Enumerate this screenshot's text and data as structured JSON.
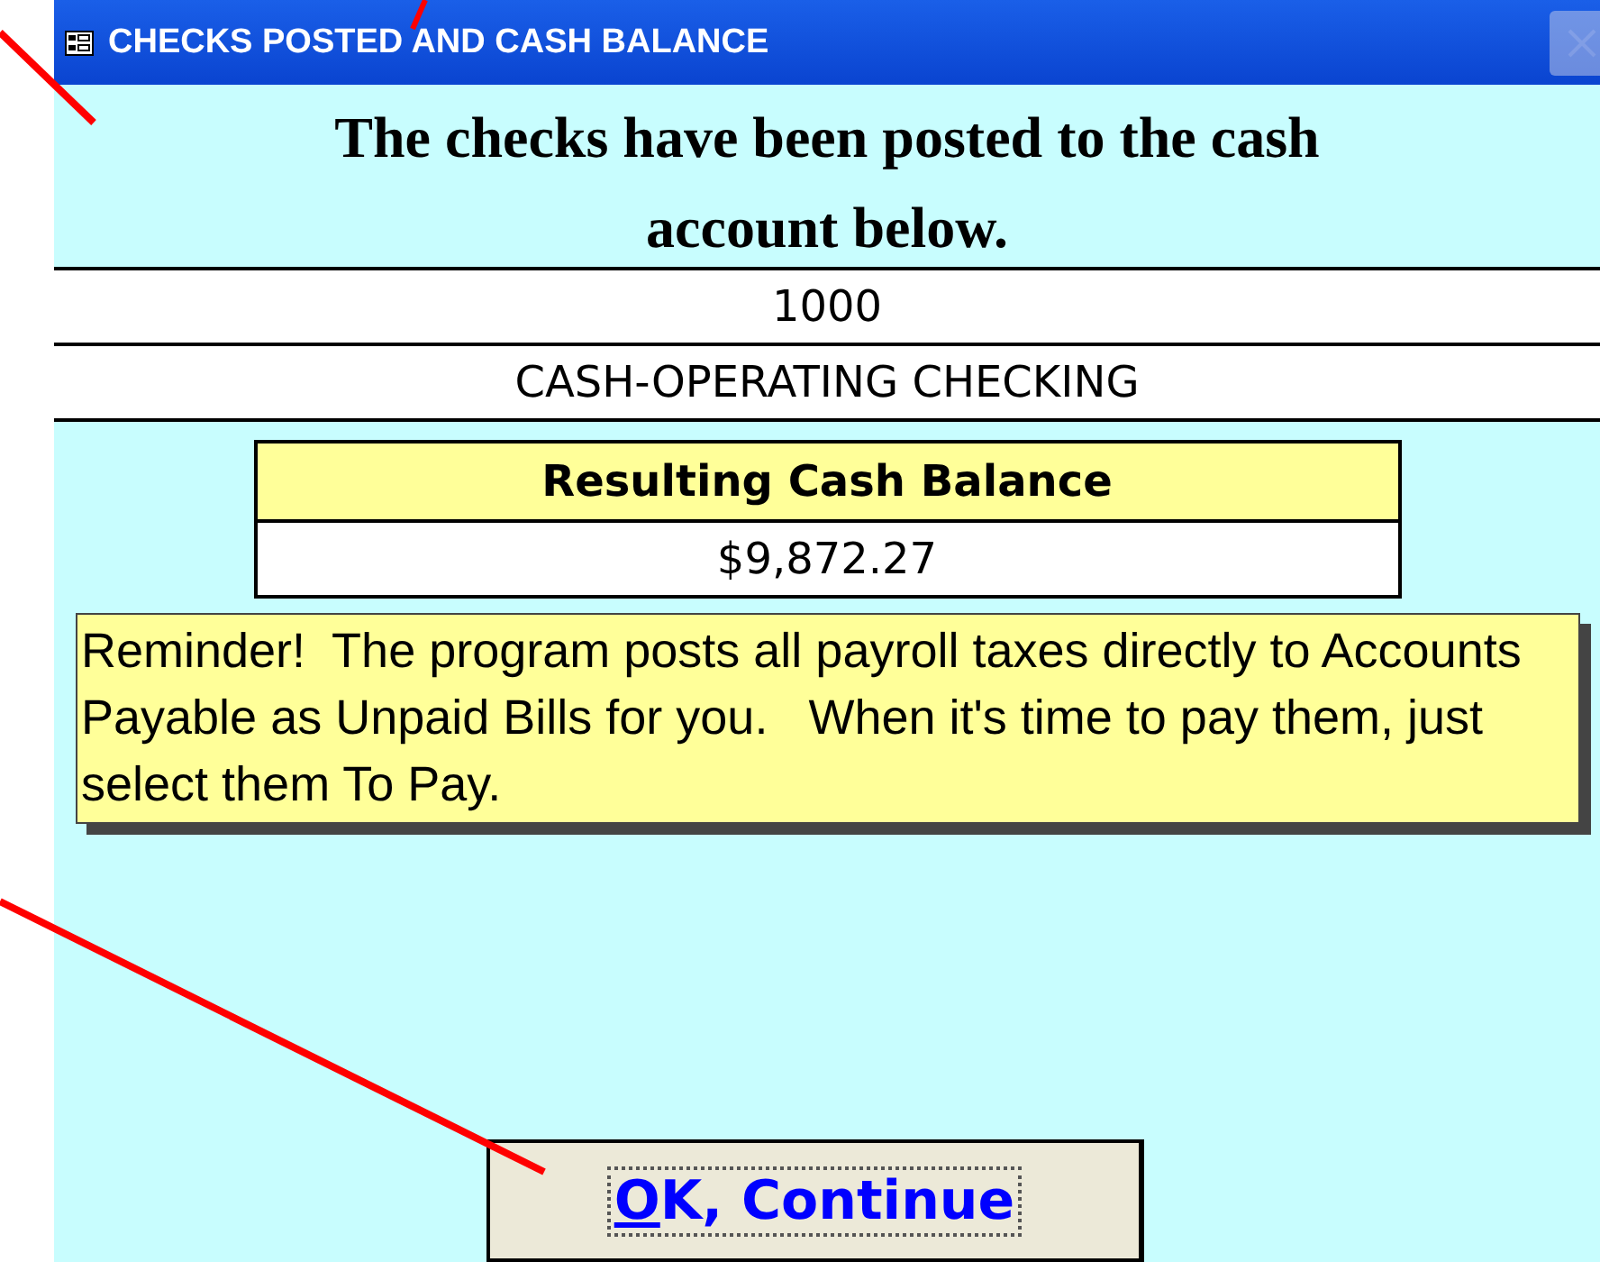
{
  "window": {
    "title": "CHECKS POSTED AND CASH BALANCE"
  },
  "heading": "The checks have been posted to the cash account below.",
  "account": {
    "number": "1000",
    "name": "CASH-OPERATING CHECKING"
  },
  "balance": {
    "label": "Resulting Cash Balance",
    "value": "$9,872.27"
  },
  "reminder": "Reminder!  The program posts all payroll taxes directly to Accounts Payable as Unpaid Bills for you.   When it's time to pay them, just select them To Pay.",
  "button": {
    "label": "OK, Continue",
    "focused": true
  }
}
